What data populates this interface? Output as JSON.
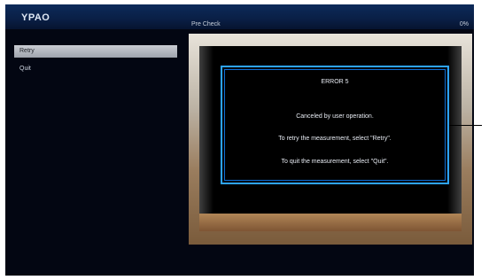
{
  "header": {
    "brand": "YPAO",
    "title": "Pre Check",
    "progress_percent_text": "0%"
  },
  "sidebar": {
    "items": [
      {
        "label": "Retry",
        "selected": true
      },
      {
        "label": "Quit",
        "selected": false
      }
    ]
  },
  "dialog": {
    "heading": "ERROR 5",
    "line1": "Canceled by user operation.",
    "line2": "To retry the measurement, select \"Retry\".",
    "line3": "To quit the measurement, select \"Quit\"."
  },
  "colors": {
    "accent_border": "#2ea4ff",
    "screen_bg": "#030612",
    "topbar": "#0c2a5a",
    "selected_item": "#c9ccd3"
  }
}
